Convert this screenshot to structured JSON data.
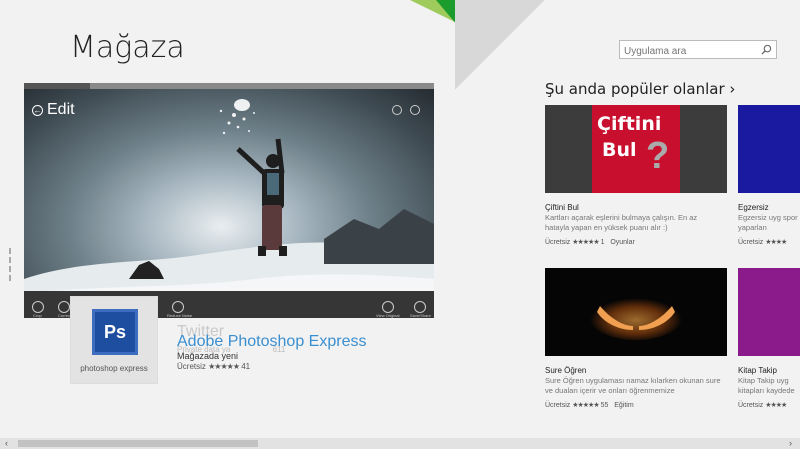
{
  "header": {
    "title": "Mağaza"
  },
  "search": {
    "placeholder": "Uygulama ara"
  },
  "hero": {
    "edit_label": "Edit",
    "toolbar_labels": [
      "Crop",
      "Correct",
      "Reduce Noise",
      "View Original",
      "Save/Share"
    ]
  },
  "featured": {
    "tile_label": "photoshop express",
    "logo_text": "Ps",
    "ghost_name": "Twitter",
    "ghost_sub": "Private data ya",
    "ghost_count": "611",
    "name": "Adobe Photoshop Express",
    "subtitle": "Mağazada yeni",
    "price": "Ücretsiz",
    "stars": "★★★★★",
    "rating_count": "41"
  },
  "popular": {
    "heading": "Şu anda popüler olanlar",
    "cards": [
      {
        "title": "Çiftini Bul",
        "image_text_1": "Çiftini",
        "image_text_2": "Bul",
        "desc": "Kartları açarak eşlerini bulmaya çalışın. En az hatayla yapan en yüksek puanı alır :)",
        "price": "Ücretsiz",
        "stars": "★★★★★",
        "count": "1",
        "category": "Oyunlar"
      },
      {
        "title": "Egzersiz",
        "desc": "Egzersiz uyg spor yaparlan",
        "price": "Ücretsiz",
        "stars": "★★★★"
      },
      {
        "title": "Sure Öğren",
        "desc": "Sure Öğren uygulaması namaz kılarken okunan sure ve duaları içerir ve onları öğrenmemize",
        "price": "Ücretsiz",
        "stars": "★★★★★",
        "count": "55",
        "category": "Eğitim"
      },
      {
        "title": "Kitap Takip",
        "desc": "Kitap Takip uyg kitapları kaydede",
        "price": "Ücretsiz",
        "stars": "★★★★"
      }
    ]
  },
  "colors": {
    "accent_green": "#1c9c2c",
    "light_green": "#9ecb5b",
    "link_blue": "#3a8fd0",
    "purple_tile": "#8b1a8a",
    "blue_tile": "#1a1aa0"
  }
}
